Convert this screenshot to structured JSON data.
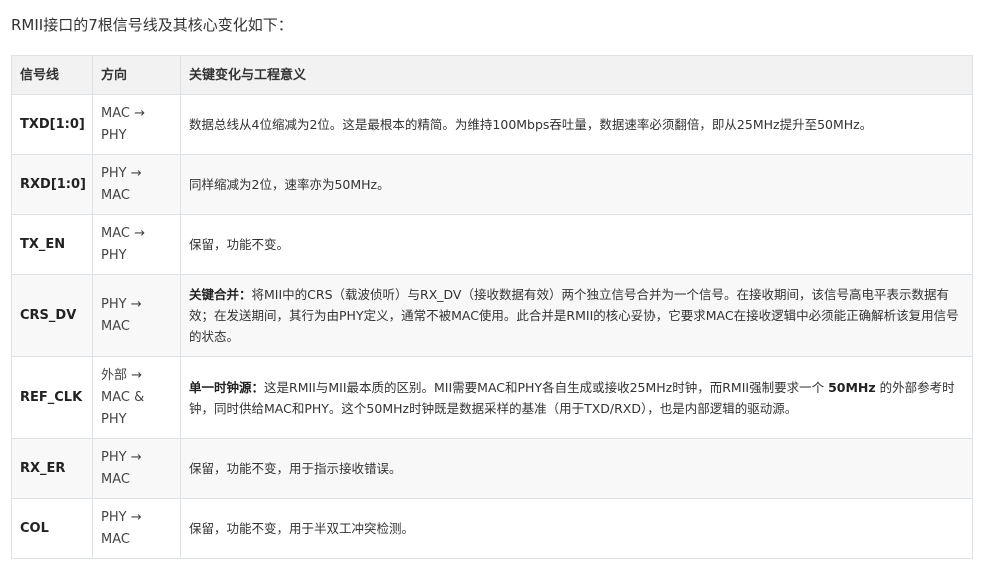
{
  "intro": "RMII接口的7根信号线及其核心变化如下：",
  "table": {
    "headers": [
      "信号线",
      "方向",
      "关键变化与工程意义"
    ],
    "rows": [
      {
        "signal": "TXD[1:0]",
        "direction": "MAC → PHY",
        "desc_lead": "",
        "desc_pre": "数据总线从4位缩减为2位。这是最根本的精简。为维持100Mbps吞吐量，数据速率必须翻倍，即从25MHz提升至50MHz。",
        "desc_bold": "",
        "desc_post": ""
      },
      {
        "signal": "RXD[1:0]",
        "direction": "PHY → MAC",
        "desc_lead": "",
        "desc_pre": "同样缩减为2位，速率亦为50MHz。",
        "desc_bold": "",
        "desc_post": ""
      },
      {
        "signal": "TX_EN",
        "direction": "MAC → PHY",
        "desc_lead": "",
        "desc_pre": "保留，功能不变。",
        "desc_bold": "",
        "desc_post": ""
      },
      {
        "signal": "CRS_DV",
        "direction": "PHY → MAC",
        "desc_lead": "关键合并：",
        "desc_pre": "将MII中的CRS（载波侦听）与RX_DV（接收数据有效）两个独立信号合并为一个信号。在接收期间，该信号高电平表示数据有效；在发送期间，其行为由PHY定义，通常不被MAC使用。此合并是RMII的核心妥协，它要求MAC在接收逻辑中必须能正确解析该复用信号的状态。",
        "desc_bold": "",
        "desc_post": ""
      },
      {
        "signal": "REF_CLK",
        "direction": "外部 → MAC & PHY",
        "desc_lead": "单一时钟源：",
        "desc_pre": "这是RMII与MII最本质的区别。MII需要MAC和PHY各自生成或接收25MHz时钟，而RMII强制要求一个 ",
        "desc_bold": "50MHz",
        "desc_post": " 的外部参考时钟，同时供给MAC和PHY。这个50MHz时钟既是数据采样的基准（用于TXD/RXD），也是内部逻辑的驱动源。"
      },
      {
        "signal": "RX_ER",
        "direction": "PHY → MAC",
        "desc_lead": "",
        "desc_pre": "保留，功能不变，用于指示接收错误。",
        "desc_bold": "",
        "desc_post": ""
      },
      {
        "signal": "COL",
        "direction": "PHY → MAC",
        "desc_lead": "",
        "desc_pre": "保留，功能不变，用于半双工冲突检测。",
        "desc_bold": "",
        "desc_post": ""
      }
    ]
  }
}
